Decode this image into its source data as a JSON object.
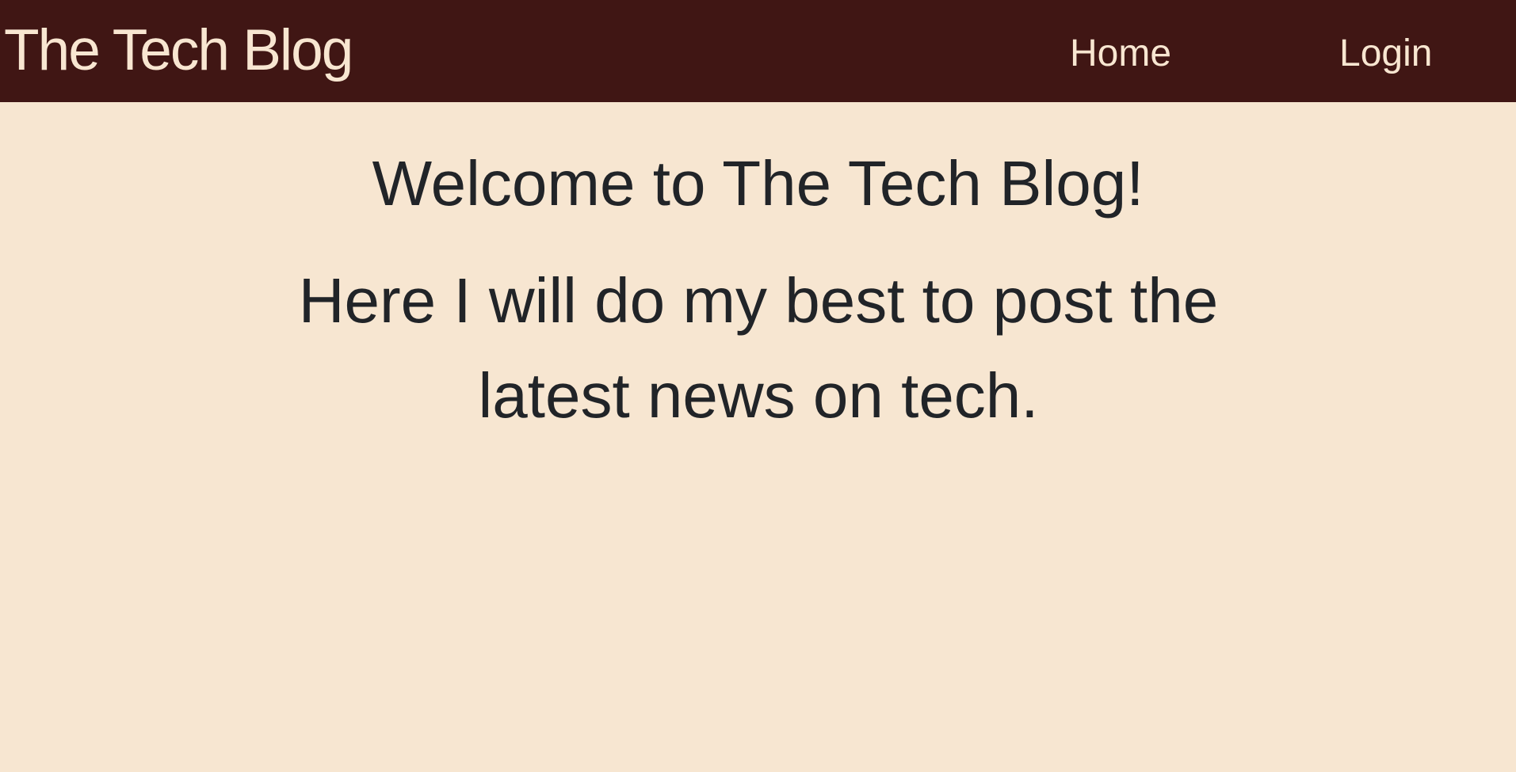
{
  "navbar": {
    "brand": "The Tech Blog",
    "links": [
      {
        "label": "Home"
      },
      {
        "label": "Login"
      }
    ]
  },
  "main": {
    "heading": "Welcome to The Tech Blog!",
    "tagline": "Here I will do my best to post the latest news on tech."
  },
  "colors": {
    "navbar_background": "#401614",
    "page_background": "#f7e6d1",
    "nav_text": "#f8e6d1",
    "body_text": "#212428"
  }
}
